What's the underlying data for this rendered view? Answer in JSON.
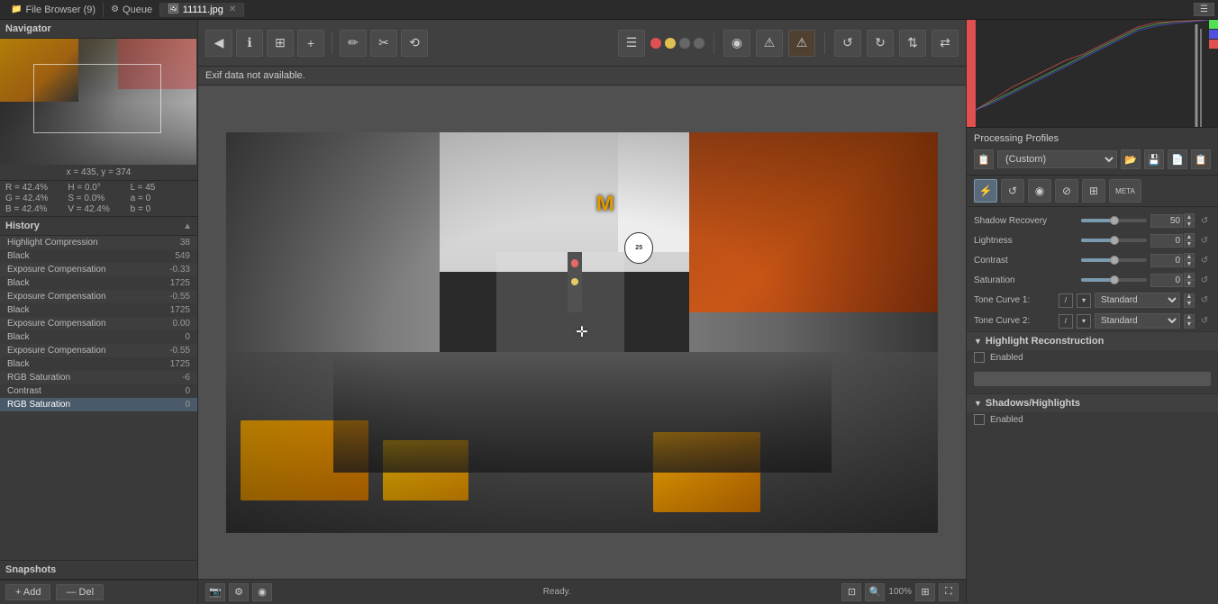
{
  "tabBar": {
    "tabs": [
      {
        "id": "file-browser",
        "label": "File Browser (9)",
        "icon": "📁",
        "active": false,
        "closeable": false
      },
      {
        "id": "queue",
        "label": "Queue",
        "icon": "⚙",
        "active": false,
        "closeable": false
      },
      {
        "id": "image",
        "label": "11111.jpg",
        "icon": "🖼",
        "active": true,
        "closeable": true
      }
    ],
    "corner_button": "☰"
  },
  "leftPanel": {
    "navigator": {
      "title": "Navigator"
    },
    "coords": {
      "xy": "x = 435, y = 374"
    },
    "colorInfo": {
      "r_label": "R =",
      "r_val": "42.4%",
      "h_label": "H =",
      "h_val": "0.0°",
      "l_label": "L =",
      "l_val": "45",
      "g_label": "G =",
      "g_val": "42.4%",
      "s_label": "S =",
      "s_val": "0.0%",
      "a_label": "a =",
      "a_val": "0",
      "b_label": "B =",
      "b_val": "42.4%",
      "v_label": "V =",
      "v_val": "42.4%",
      "b2_label": "b =",
      "b2_val": "0"
    },
    "history": {
      "title": "History",
      "items": [
        {
          "name": "Highlight Compression",
          "value": "38"
        },
        {
          "name": "Black",
          "value": "549"
        },
        {
          "name": "Exposure Compensation",
          "value": "-0.33"
        },
        {
          "name": "Black",
          "value": "1725"
        },
        {
          "name": "Exposure Compensation",
          "value": "-0.55"
        },
        {
          "name": "Black",
          "value": "1725"
        },
        {
          "name": "Exposure Compensation",
          "value": "0.00"
        },
        {
          "name": "Black",
          "value": "0"
        },
        {
          "name": "Exposure Compensation",
          "value": "-0.55"
        },
        {
          "name": "Black",
          "value": "1725"
        },
        {
          "name": "RGB Saturation",
          "value": "-6"
        },
        {
          "name": "Contrast",
          "value": "0"
        },
        {
          "name": "RGB Saturation",
          "value": "0"
        }
      ]
    },
    "snapshots": {
      "title": "Snapshots",
      "add_label": "+ Add",
      "del_label": "— Del"
    }
  },
  "toolbar": {
    "back_btn": "◀",
    "info_btn": "ℹ",
    "copy_btn": "⊞",
    "add_btn": "+",
    "edit_btn": "✏",
    "crop_btn": "✂",
    "transform_btn": "⟲",
    "traffic_red": "#e05050",
    "traffic_yellow": "#e0c050",
    "traffic_gray": "#666666",
    "menu_btn": "☰",
    "warning_btn": "⚠",
    "warning2_btn": "⚠",
    "rotate_l": "↺",
    "rotate_r": "↻",
    "flip_btn": "⇅",
    "flip2_btn": "⇄"
  },
  "exifBar": {
    "text": "Exif data not available."
  },
  "imageArea": {
    "alt": "Street photography - New York City crowd"
  },
  "bottomBar": {
    "status": "Ready.",
    "zoom": "100%"
  },
  "rightPanel": {
    "processingProfiles": {
      "title": "Processing Profiles",
      "current": "(Custom)",
      "icons": [
        "📋",
        "📂",
        "💾",
        "📄"
      ]
    },
    "toolsRow": {
      "icons": [
        "⚡",
        "↺",
        "◉",
        "⊘",
        "⊞",
        "META"
      ]
    },
    "sliders": {
      "shadowRecovery": {
        "label": "Shadow Recovery",
        "value": 50,
        "min": 0,
        "max": 100
      },
      "lightness": {
        "label": "Lightness",
        "value": 0,
        "min": -100,
        "max": 100
      },
      "contrast": {
        "label": "Contrast",
        "value": 0,
        "min": -100,
        "max": 100
      },
      "saturation": {
        "label": "Saturation",
        "value": 0,
        "min": -100,
        "max": 100
      }
    },
    "toneCurves": {
      "curve1": {
        "label": "Tone Curve 1:",
        "mode": "Standard"
      },
      "curve2": {
        "label": "Tone Curve 2:",
        "mode": "Standard"
      }
    },
    "highlightReconstruction": {
      "title": "Highlight Reconstruction",
      "enabled": false,
      "enabled_label": "Enabled"
    },
    "shadowsHighlights": {
      "title": "Shadows/Highlights",
      "enabled_label": "Enabled"
    }
  }
}
